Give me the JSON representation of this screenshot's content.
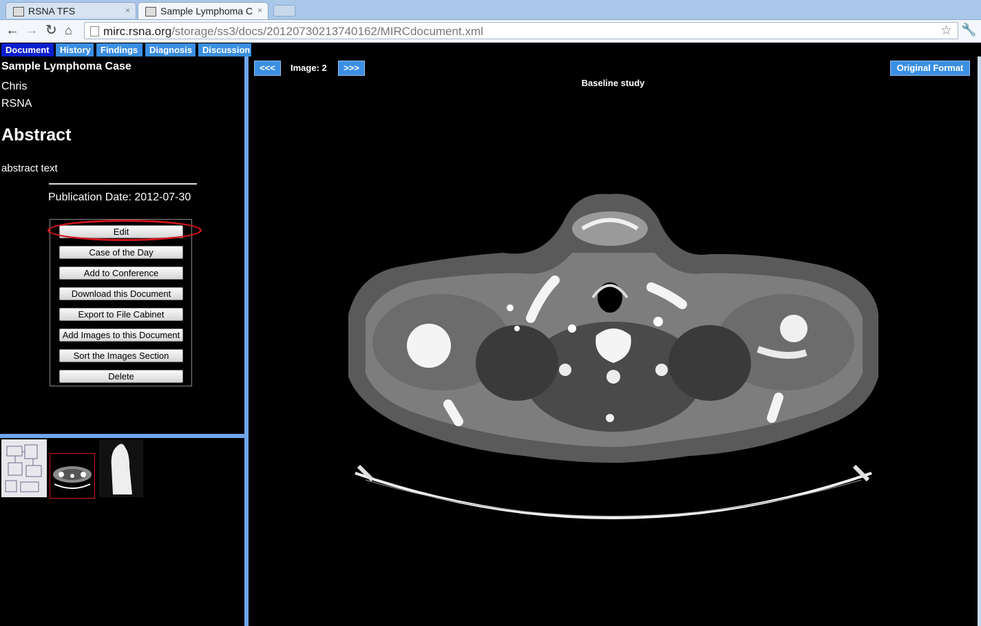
{
  "browser": {
    "tabs": [
      {
        "label": "RSNA TFS",
        "close": "×"
      },
      {
        "label": "Sample Lymphoma C",
        "close": "×"
      }
    ],
    "url_host": "mirc.rsna.org",
    "url_path": "/storage/ss3/docs/20120730213740162/MIRCdocument.xml"
  },
  "app_tabs": [
    "Document",
    "History",
    "Findings",
    "Diagnosis",
    "Discussion"
  ],
  "document": {
    "title": "Sample Lymphoma Case",
    "author": "Chris",
    "affiliation": "RSNA",
    "abstract_heading": "Abstract",
    "abstract_text": "abstract text",
    "publication_date": "Publication Date: 2012-07-30"
  },
  "actions": [
    "Edit",
    "Case of the Day",
    "Add to Conference",
    "Download this Document",
    "Export to File Cabinet",
    "Add Images to this Document",
    "Sort the Images Section",
    "Delete"
  ],
  "viewer": {
    "prev_label": "<<<",
    "next_label": ">>>",
    "image_label": "Image: 2",
    "caption": "Baseline study",
    "original_format_label": "Original Format"
  },
  "colors": {
    "tab_blue": "#3b8fe3",
    "tab_selected": "#0b1fd0",
    "splitter": "#6fa6ea",
    "highlight_ring": "#d0151c"
  }
}
